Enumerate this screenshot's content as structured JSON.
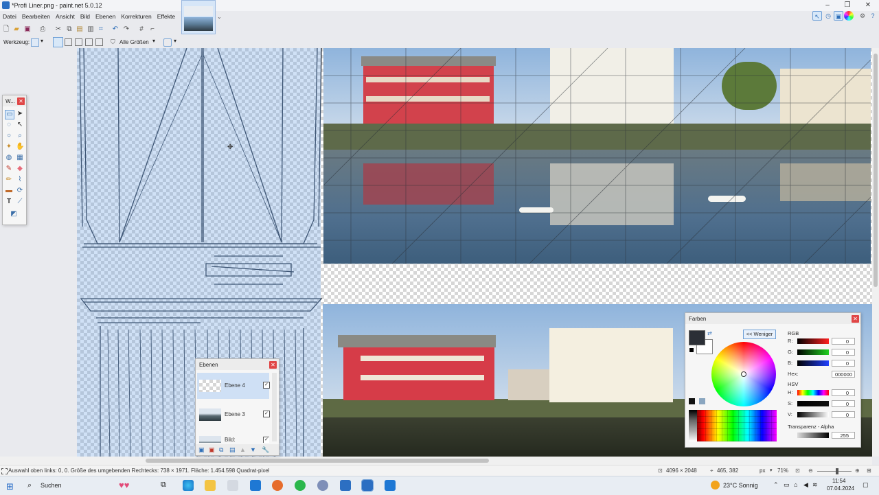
{
  "window": {
    "title": "*Profi Liner.png - paint.net 5.0.12",
    "minimize": "–",
    "restore": "❐",
    "close": "✕"
  },
  "menu": [
    "Datei",
    "Bearbeiten",
    "Ansicht",
    "Bild",
    "Ebenen",
    "Korrekturen",
    "Effekte"
  ],
  "options_bar": {
    "tool_label": "Werkzeug:",
    "sampling": "Alle Größen"
  },
  "tools_window": {
    "title": "W..."
  },
  "layers_panel": {
    "title": "Ebenen",
    "layers": [
      {
        "name": "Ebene 4",
        "visible": true,
        "selected": true
      },
      {
        "name": "Ebene 3",
        "visible": true,
        "selected": false
      },
      {
        "name": "Bild:",
        "visible": true,
        "selected": false
      }
    ]
  },
  "colors_panel": {
    "title": "Farben",
    "less_button": "<< Weniger",
    "rgb_label": "RGB",
    "r_label": "R:",
    "g_label": "G:",
    "b_label": "B:",
    "r": "0",
    "g": "0",
    "b": "0",
    "hex_label": "Hex:",
    "hex": "000000",
    "hsv_label": "HSV",
    "h_label": "H:",
    "s_label": "S:",
    "v_label": "V:",
    "h": "0",
    "s": "0",
    "v": "0",
    "alpha_label": "Transparenz - Alpha",
    "alpha": "255",
    "primary_color": "#2b2f36",
    "secondary_color": "#ffffff"
  },
  "status": {
    "selection_info": "Auswahl oben links: 0, 0. Größe des umgebenden Rechtecks: 738 × 1971. Fläche: 1.454.598 Quadrat-pixel",
    "image_size": "4096 × 2048",
    "cursor_pos": "465, 382",
    "unit": "px",
    "zoom": "71%"
  },
  "taskbar": {
    "search": "Suchen",
    "weather": "23°C  Sonnig",
    "time": "11:54",
    "date": "07.04.2024"
  }
}
